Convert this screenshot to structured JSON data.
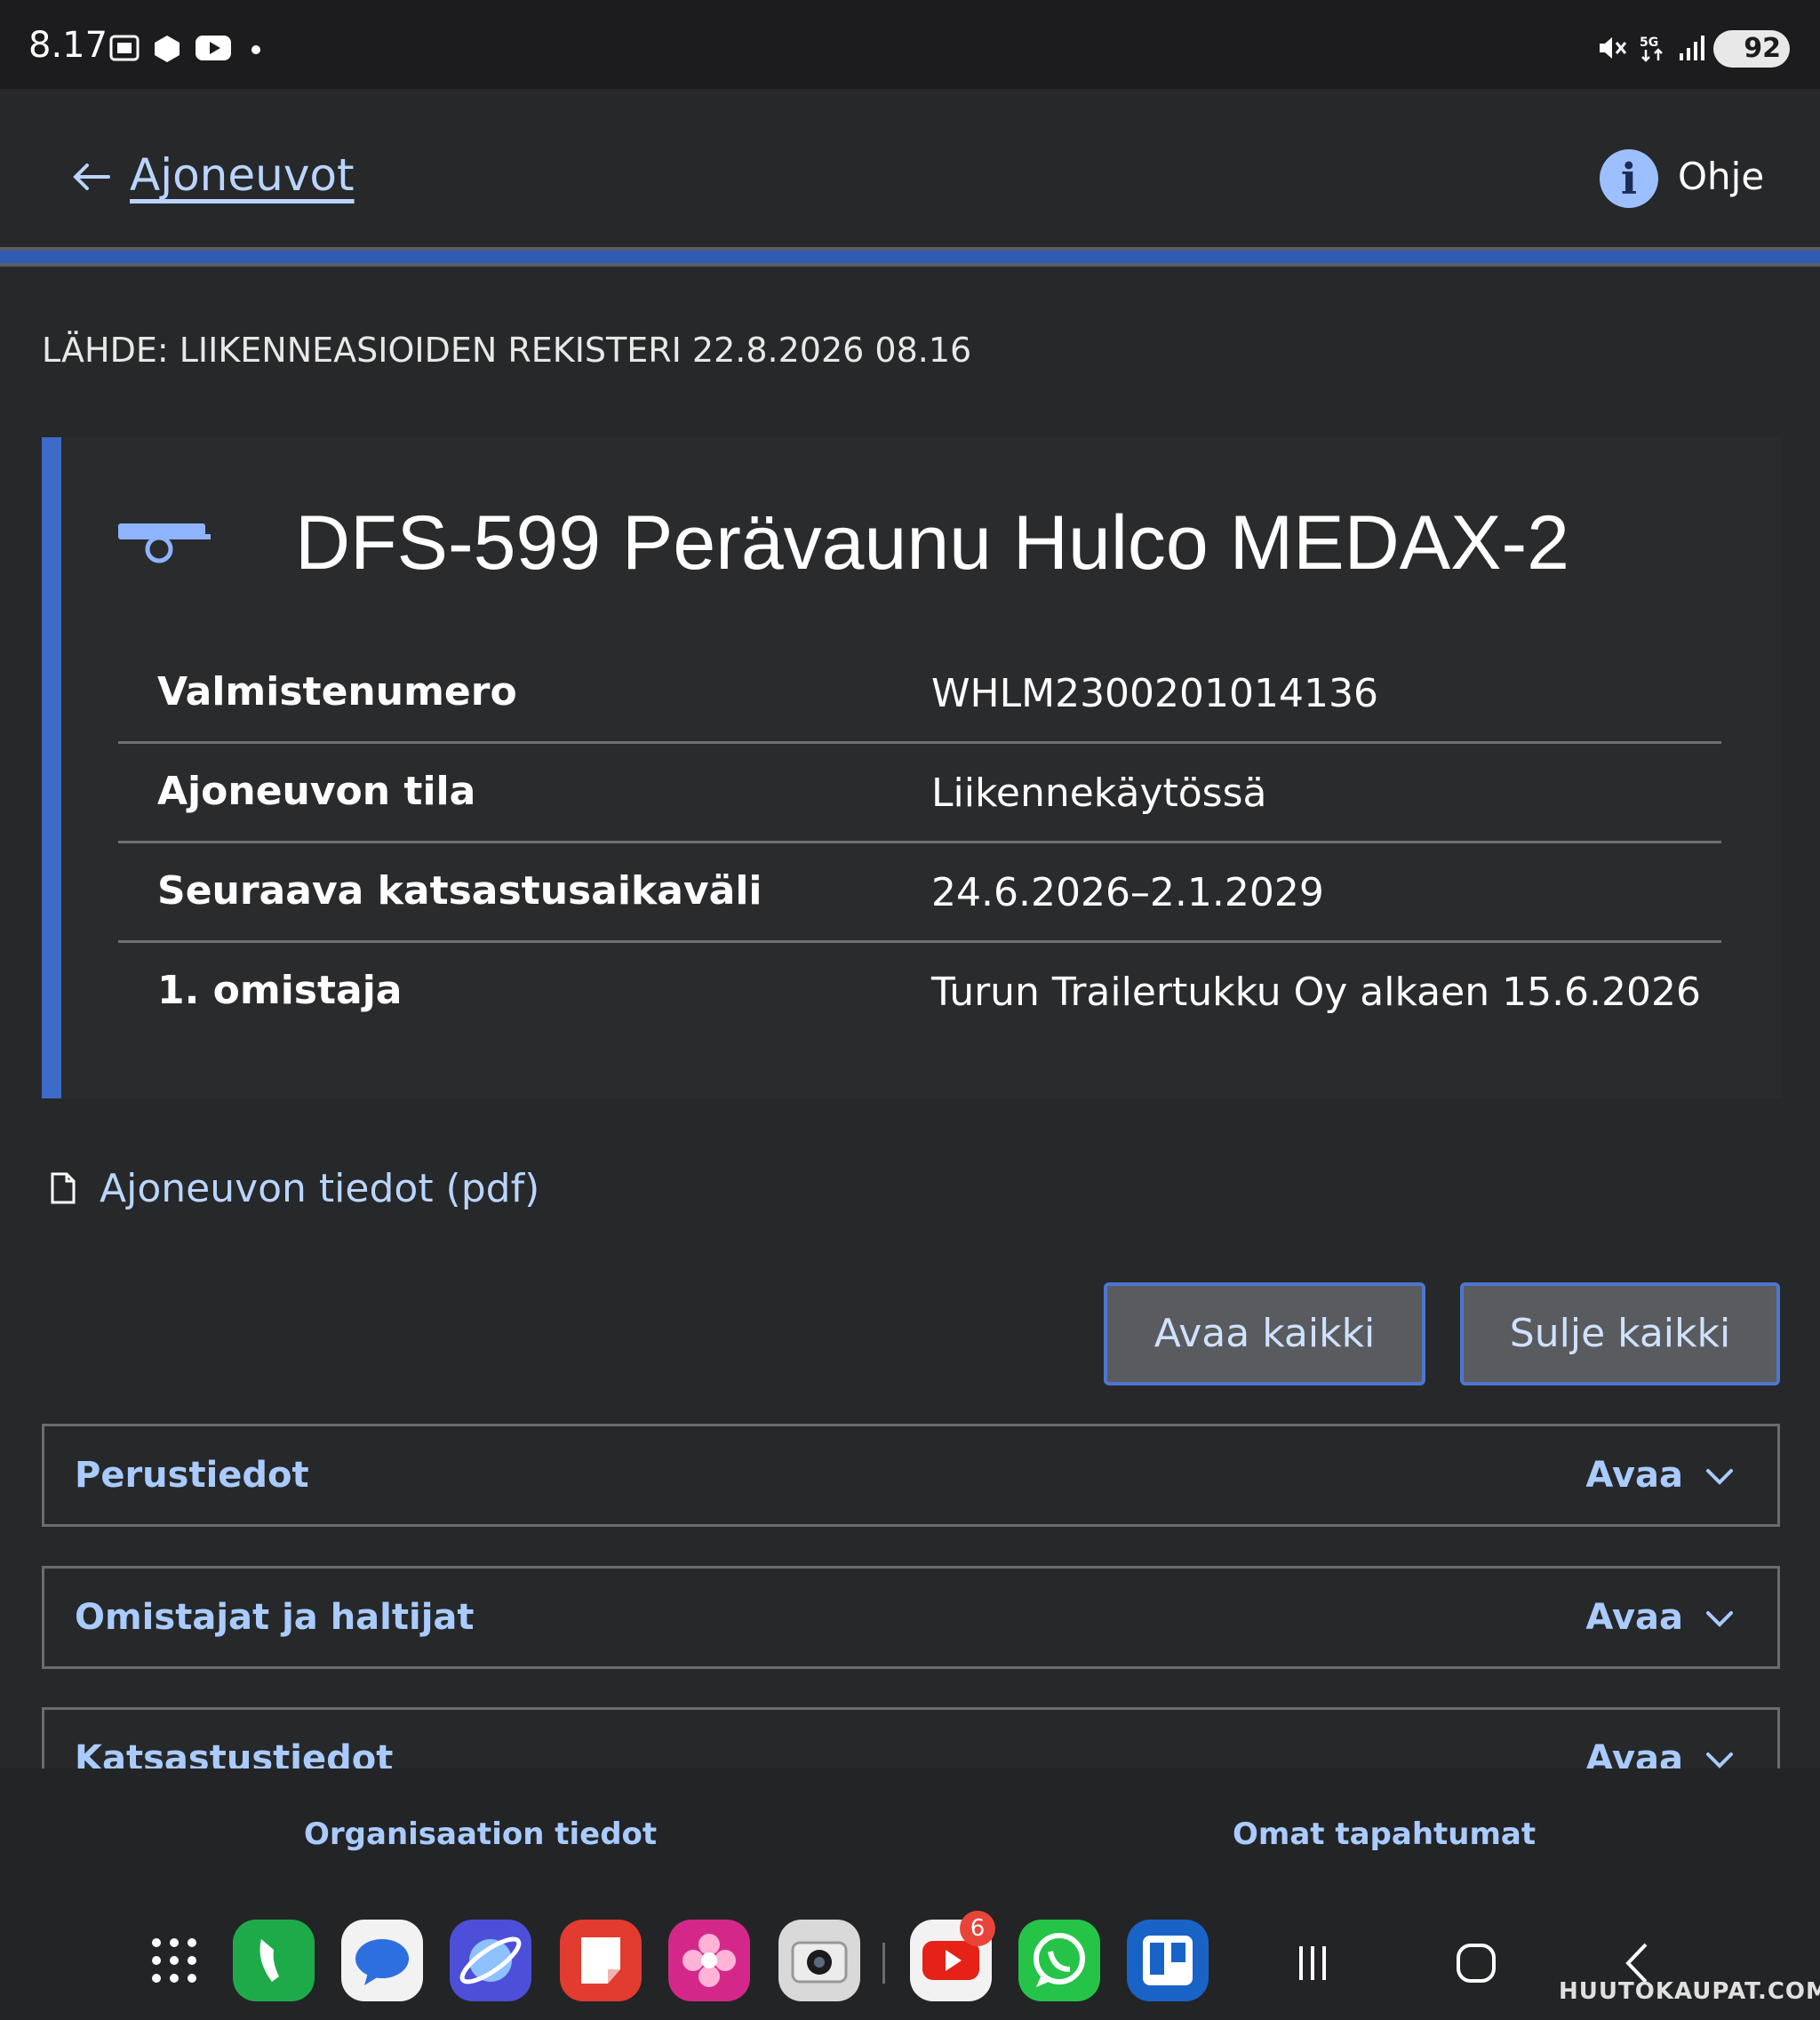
{
  "status_bar": {
    "time": "8.17",
    "battery": "92",
    "icons": [
      "screenshot-icon",
      "app-icon",
      "youtube-icon",
      "dot-icon",
      "mute-icon",
      "5g-icon",
      "signal-icon"
    ]
  },
  "header": {
    "back_label": "Ajoneuvot",
    "help_label": "Ohje",
    "info_glyph": "i"
  },
  "source_line": "LÄHDE: LIIKENNEASIOIDEN REKISTERI 22.8.2026 08.16",
  "vehicle": {
    "title": "DFS-599 Perävaunu Hulco MEDAX-2",
    "rows": [
      {
        "key": "Valmistenumero",
        "value": "WHLM2300201014136"
      },
      {
        "key": "Ajoneuvon tila",
        "value": "Liikennekäytössä"
      },
      {
        "key": "Seuraava katsastusaikaväli",
        "value": "24.6.2026–2.1.2029"
      },
      {
        "key": "1. omistaja",
        "value": "Turun Trailertukku Oy alkaen 15.6.2026"
      }
    ]
  },
  "pdf_link": "Ajoneuvon tiedot (pdf)",
  "buttons": {
    "open_all": "Avaa kaikki",
    "close_all": "Sulje kaikki"
  },
  "accordions": [
    {
      "title": "Perustiedot",
      "action": "Avaa"
    },
    {
      "title": "Omistajat ja haltijat",
      "action": "Avaa"
    },
    {
      "title": "Katsastustiedot",
      "action": "Avaa"
    }
  ],
  "bottom_nav": {
    "org": "Organisaation tiedot",
    "events": "Omat tapahtumat"
  },
  "dock": {
    "youtube_badge": "6",
    "apps": [
      "apps-grid-icon",
      "phone-icon",
      "messages-icon",
      "internet-icon",
      "notes-icon",
      "gallery-icon",
      "camera-icon",
      "youtube-icon",
      "whatsapp-icon",
      "trello-icon"
    ]
  },
  "watermark": "HUUTOKAUPAT.COM",
  "colors": {
    "accent": "#3e6ac8",
    "link": "#b9d5ff",
    "accordion_text": "#a9cbff",
    "background": "#272829"
  }
}
